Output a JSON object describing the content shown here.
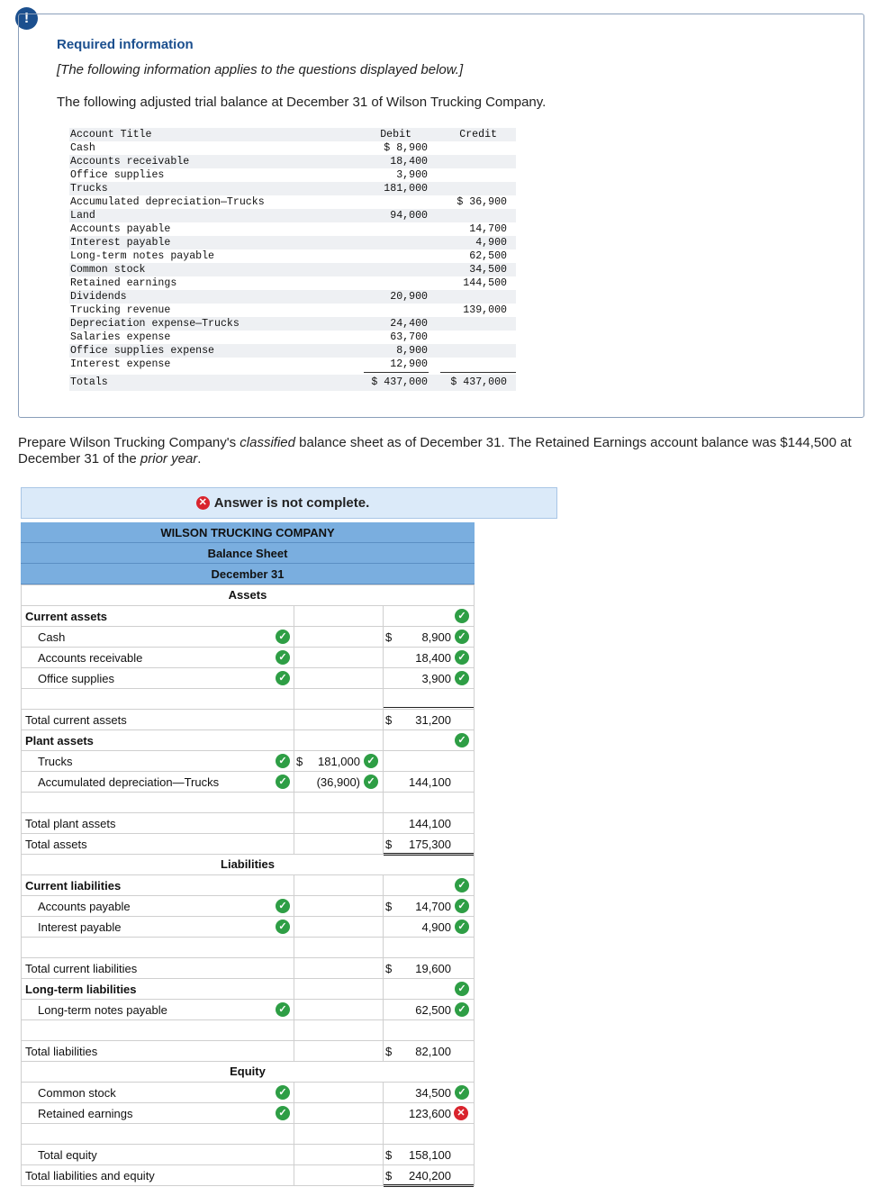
{
  "header": {
    "alert_glyph": "!",
    "title": "Required information",
    "note": "[The following information applies to the questions displayed below.]",
    "intro": "The following adjusted trial balance at December 31 of Wilson Trucking Company."
  },
  "trial_balance": {
    "headers": {
      "account": "Account Title",
      "debit": "Debit",
      "credit": "Credit"
    },
    "rows": [
      {
        "account": "Cash",
        "debit": "$ 8,900",
        "credit": ""
      },
      {
        "account": "Accounts receivable",
        "debit": "18,400",
        "credit": ""
      },
      {
        "account": "Office supplies",
        "debit": "3,900",
        "credit": ""
      },
      {
        "account": "Trucks",
        "debit": "181,000",
        "credit": ""
      },
      {
        "account": "Accumulated depreciation—Trucks",
        "debit": "",
        "credit": "$ 36,900"
      },
      {
        "account": "Land",
        "debit": "94,000",
        "credit": ""
      },
      {
        "account": "Accounts payable",
        "debit": "",
        "credit": "14,700"
      },
      {
        "account": "Interest payable",
        "debit": "",
        "credit": "4,900"
      },
      {
        "account": "Long-term notes payable",
        "debit": "",
        "credit": "62,500"
      },
      {
        "account": "Common stock",
        "debit": "",
        "credit": "34,500"
      },
      {
        "account": "Retained earnings",
        "debit": "",
        "credit": "144,500"
      },
      {
        "account": "Dividends",
        "debit": "20,900",
        "credit": ""
      },
      {
        "account": "Trucking revenue",
        "debit": "",
        "credit": "139,000"
      },
      {
        "account": "Depreciation expense—Trucks",
        "debit": "24,400",
        "credit": ""
      },
      {
        "account": "Salaries expense",
        "debit": "63,700",
        "credit": ""
      },
      {
        "account": "Office supplies expense",
        "debit": "8,900",
        "credit": ""
      },
      {
        "account": "Interest expense",
        "debit": "12,900",
        "credit": ""
      }
    ],
    "totals": {
      "account": "Totals",
      "debit": "$ 437,000",
      "credit": "$ 437,000"
    }
  },
  "prompt": {
    "part1": "Prepare Wilson Trucking Company's ",
    "emph1": "classified",
    "part2": " balance sheet as of December 31. The Retained Earnings account balance was $144,500 at December 31 of the ",
    "emph2": "prior year",
    "part3": "."
  },
  "status": {
    "icon": "✕",
    "text": "Answer is not complete."
  },
  "balance_sheet": {
    "company": "WILSON TRUCKING COMPANY",
    "statement": "Balance Sheet",
    "date": "December 31",
    "assets_heading": "Assets",
    "liabilities_heading": "Liabilities",
    "equity_heading": "Equity",
    "current_assets_label": "Current assets",
    "cash": {
      "label": "Cash",
      "dollar": "$",
      "amount": "8,900"
    },
    "ar": {
      "label": "Accounts receivable",
      "amount": "18,400"
    },
    "supplies": {
      "label": "Office supplies",
      "amount": "3,900"
    },
    "total_current_assets": {
      "label": "Total current assets",
      "dollar": "$",
      "amount": "31,200"
    },
    "plant_assets_label": "Plant assets",
    "trucks": {
      "label": "Trucks",
      "dollar": "$",
      "amount": "181,000"
    },
    "accum_dep": {
      "label": "Accumulated depreciation—Trucks",
      "amount": "(36,900)",
      "net": "144,100"
    },
    "total_plant_assets": {
      "label": "Total plant assets",
      "amount": "144,100"
    },
    "total_assets": {
      "label": "Total assets",
      "dollar": "$",
      "amount": "175,300"
    },
    "current_liabilities_label": "Current liabilities",
    "ap": {
      "label": "Accounts payable",
      "dollar": "$",
      "amount": "14,700"
    },
    "ip": {
      "label": "Interest payable",
      "amount": "4,900"
    },
    "total_current_liabilities": {
      "label": "Total current liabilities",
      "dollar": "$",
      "amount": "19,600"
    },
    "long_term_label": "Long-term liabilities",
    "ltnp": {
      "label": "Long-term notes payable",
      "amount": "62,500"
    },
    "total_liabilities": {
      "label": "Total liabilities",
      "dollar": "$",
      "amount": "82,100"
    },
    "common_stock": {
      "label": "Common stock",
      "amount": "34,500"
    },
    "retained_earnings": {
      "label": "Retained earnings",
      "amount": "123,600"
    },
    "total_equity": {
      "label": "Total equity",
      "dollar": "$",
      "amount": "158,100"
    },
    "total_le": {
      "label": "Total liabilities and equity",
      "dollar": "$",
      "amount": "240,200"
    },
    "check_glyph": "✓",
    "cross_glyph": "✕"
  }
}
